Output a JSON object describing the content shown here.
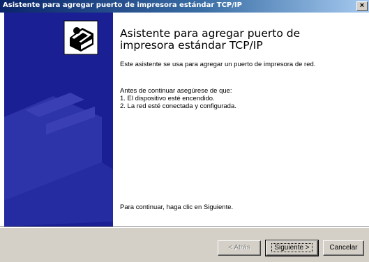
{
  "window": {
    "title": "Asistente para agregar puerto de impresora estándar TCP/IP",
    "close_label": "×"
  },
  "wizard": {
    "heading": "Asistente para agregar puerto de impresora estándar TCP/IP",
    "intro": "Este asistente se usa para agregar un puerto de impresora de red.",
    "check_intro": "Antes de continuar asegúrese de que:",
    "checks": [
      "1.  El dispositivo esté encendido.",
      "2.  La red esté conectada y configurada."
    ],
    "continue_text": "Para continuar, haga clic en Siguiente."
  },
  "buttons": {
    "back": "< Atrás",
    "next": "Siguiente >",
    "cancel": "Cancelar"
  },
  "colors": {
    "banner": "#1b1f94",
    "titlebar_start": "#0a246a",
    "titlebar_end": "#a6caf0"
  },
  "icons": {
    "banner": "printer-icon"
  }
}
